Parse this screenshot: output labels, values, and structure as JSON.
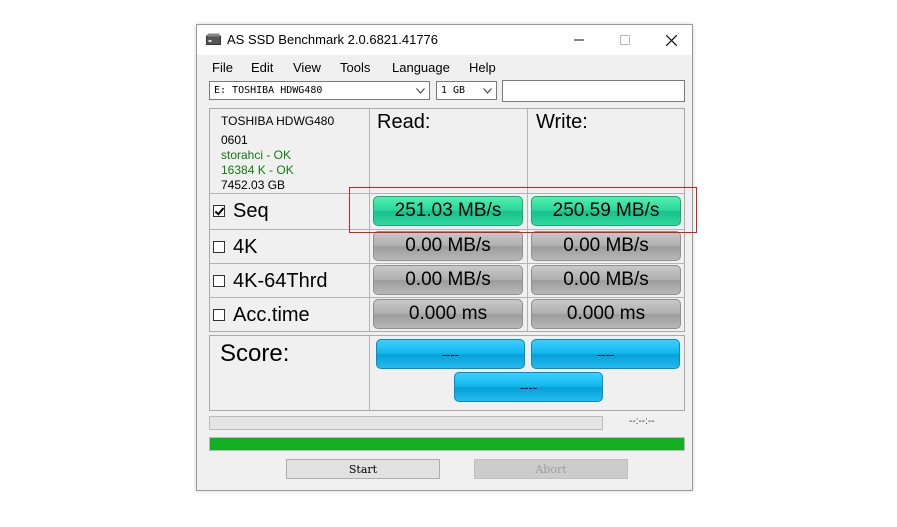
{
  "window": {
    "title": "AS SSD Benchmark 2.0.6821.41776"
  },
  "menu": [
    "File",
    "Edit",
    "View",
    "Tools",
    "Language",
    "Help"
  ],
  "drive_select": {
    "value": "E: TOSHIBA HDWG480"
  },
  "size_select": {
    "value": "1 GB"
  },
  "drive_info": {
    "model": "TOSHIBA HDWG480",
    "firmware": "0601",
    "driver": "storahci - OK",
    "alignment": "16384 K - OK",
    "capacity": "7452.03 GB"
  },
  "headers": {
    "read": "Read:",
    "write": "Write:"
  },
  "rows": [
    {
      "label": "Seq",
      "checked": true,
      "read": "251.03 MB/s",
      "write": "250.59 MB/s",
      "state": "done"
    },
    {
      "label": "4K",
      "checked": false,
      "read": "0.00 MB/s",
      "write": "0.00 MB/s",
      "state": "idle"
    },
    {
      "label": "4K-64Thrd",
      "checked": false,
      "read": "0.00 MB/s",
      "write": "0.00 MB/s",
      "state": "idle"
    },
    {
      "label": "Acc.time",
      "checked": false,
      "read": "0.000 ms",
      "write": "0.000 ms",
      "state": "idle"
    }
  ],
  "score": {
    "label": "Score:",
    "read": "----",
    "write": "----",
    "total": "----"
  },
  "progress": {
    "time": "--:--:--",
    "fraction": 1.0
  },
  "buttons": {
    "start": "Start",
    "abort": "Abort"
  },
  "colors": {
    "done": "#2ad59a",
    "idle": "#b0b0b0",
    "score": "#12b6ec",
    "progress": "#13b023",
    "highlight": "#d81c1c"
  }
}
